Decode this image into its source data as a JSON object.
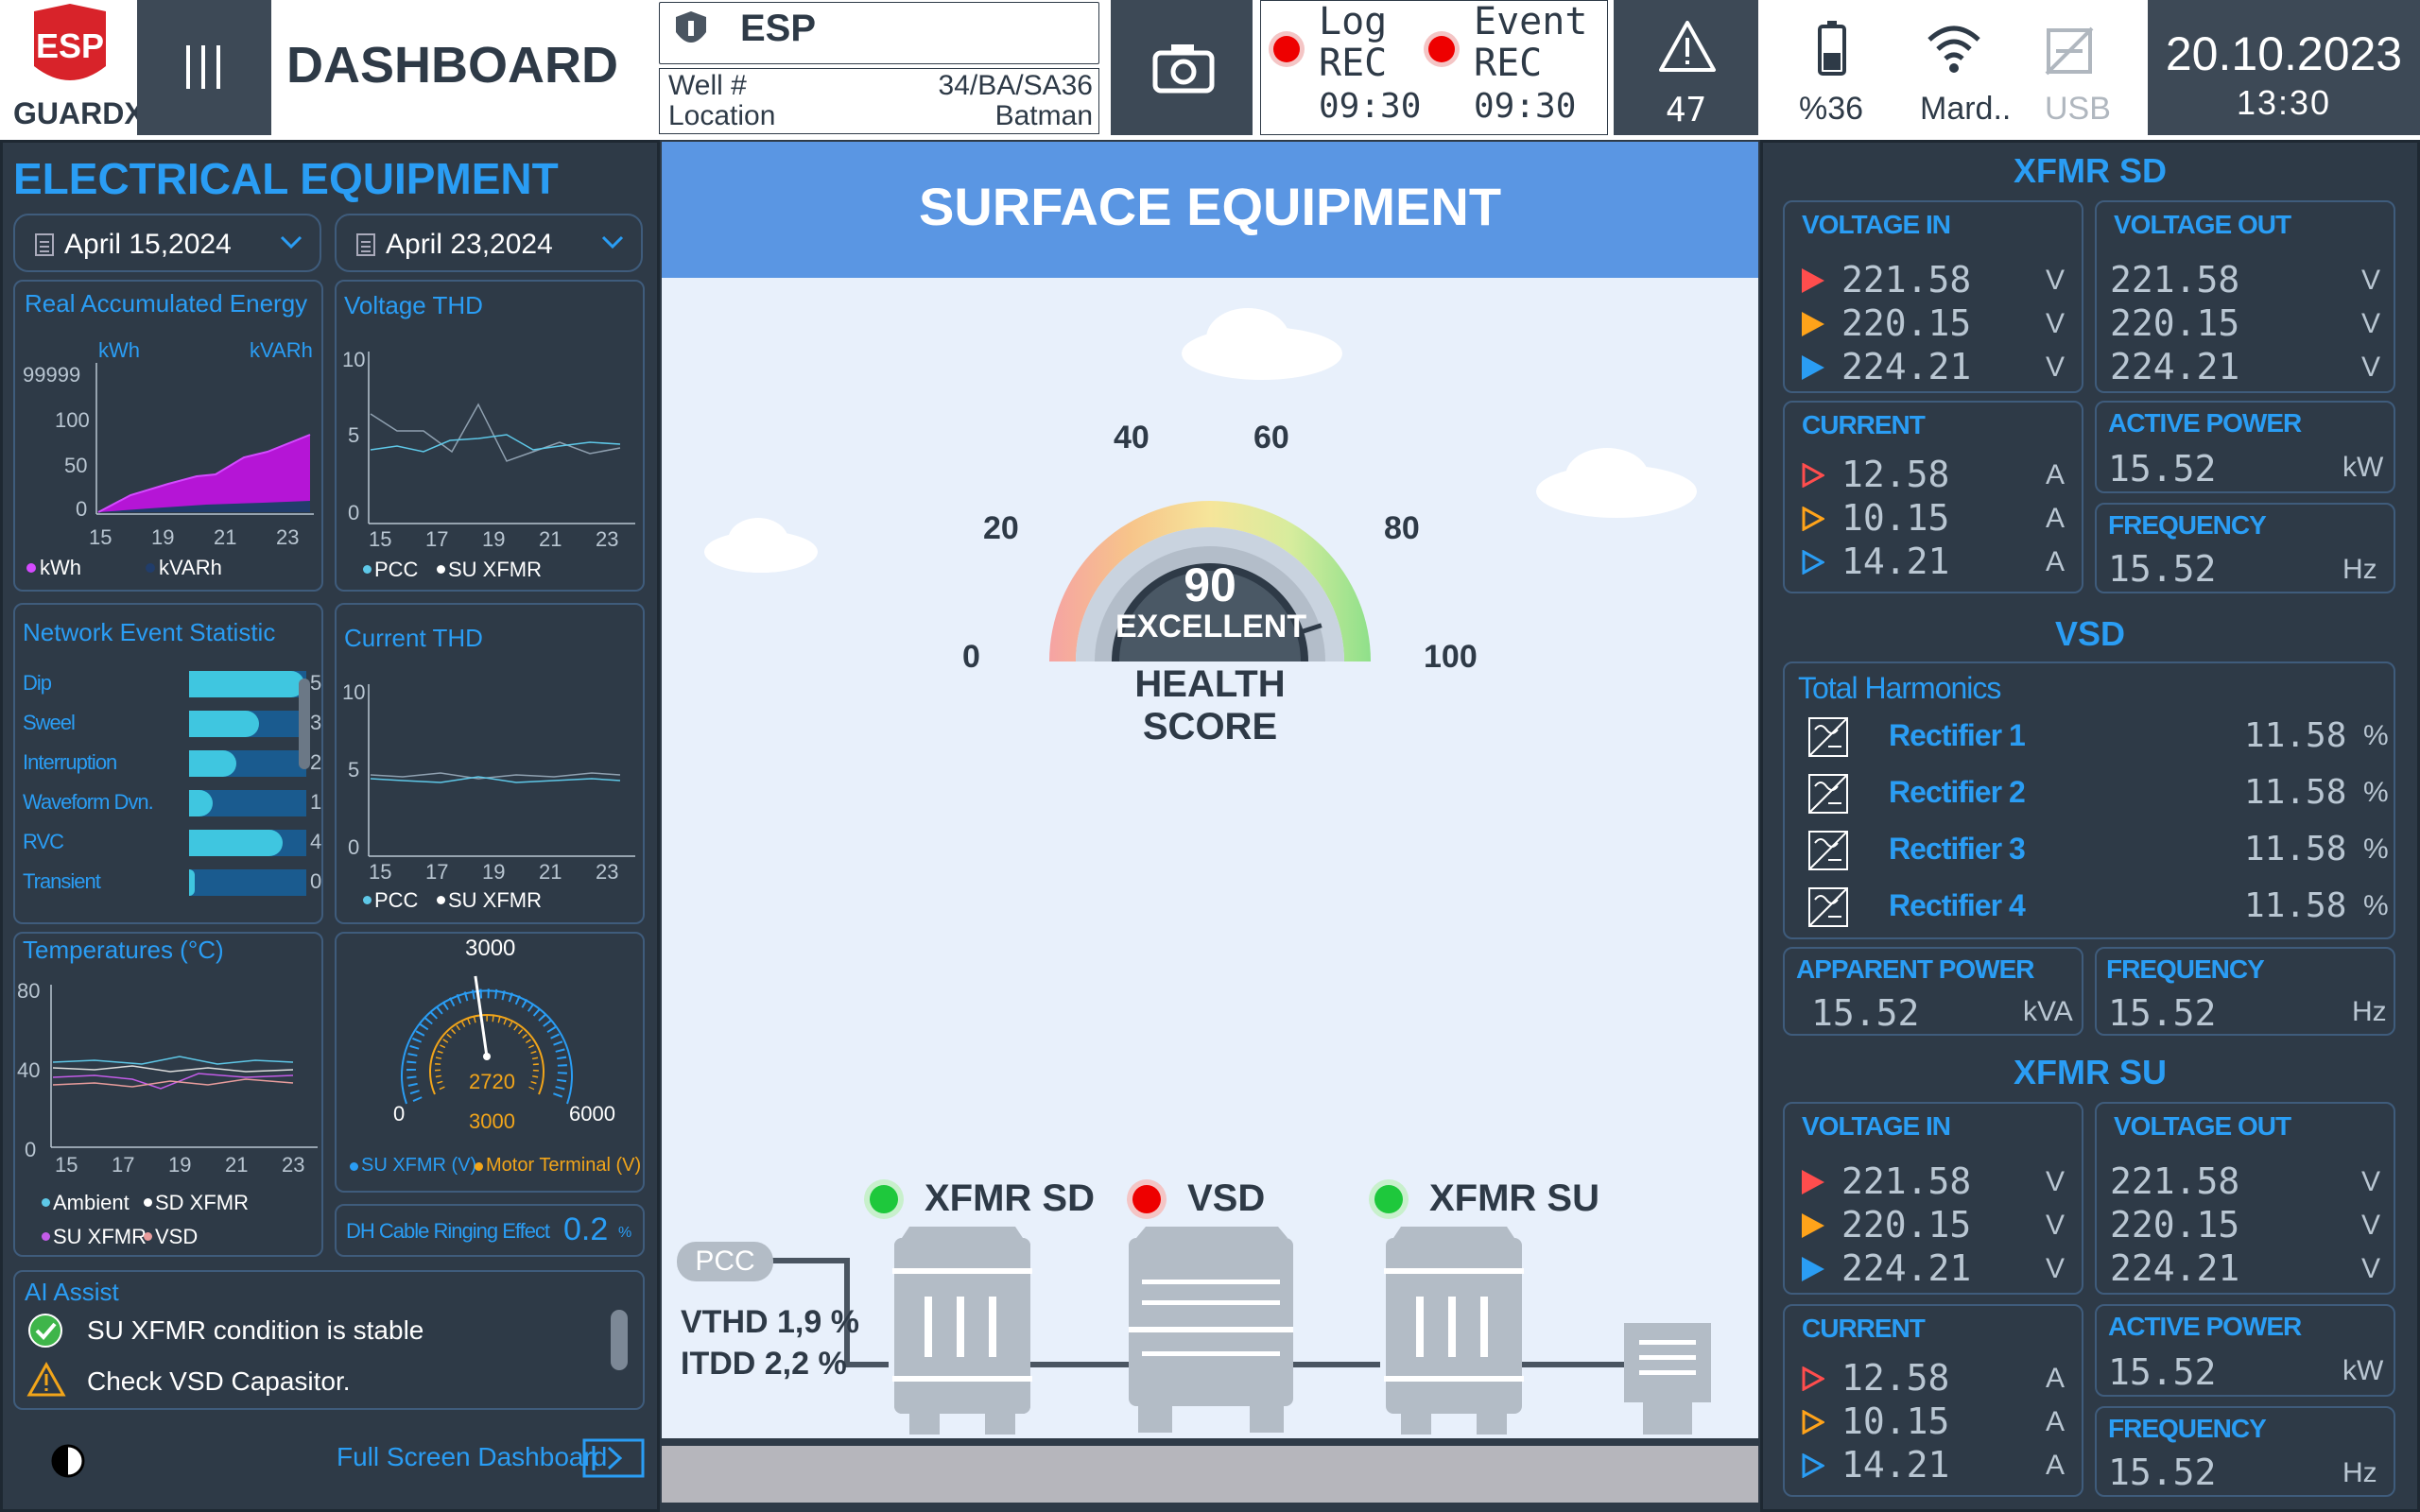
{
  "header": {
    "logo_top": "ESP",
    "logo_bottom": "GUARDX",
    "title": "DASHBOARD",
    "device": "ESP",
    "well_label": "Well #",
    "well_value": "34/BA/SA36",
    "location_label": "Location",
    "location_value": "Batman",
    "log_rec": {
      "line1": "Log",
      "line2": "REC",
      "time": "09:30"
    },
    "event_rec": {
      "line1": "Event",
      "line2": "REC",
      "time": "09:30"
    },
    "alerts": "47",
    "battery": "%36",
    "wifi": "Mard..",
    "usb": "USB",
    "date": "20.10.2023",
    "time": "13:30"
  },
  "left": {
    "title": "ELECTRICAL EQUIPMENT",
    "date_from": "April 15,2024",
    "date_to": "April 23,2024",
    "energy": {
      "title": "Real Accumulated Energy",
      "unit1": "kWh",
      "unit2": "kVARh",
      "yticks": [
        "99999",
        "100",
        "50",
        "0"
      ],
      "xticks": [
        "15",
        "19",
        "21",
        "23"
      ],
      "legend": [
        "kWh",
        "kVARh"
      ]
    },
    "vthd": {
      "title": "Voltage THD",
      "yticks": [
        "10",
        "5",
        "0"
      ],
      "xticks": [
        "15",
        "17",
        "19",
        "21",
        "23"
      ],
      "legend": [
        "PCC",
        "SU XFMR"
      ]
    },
    "network": {
      "title": "Network Event Statistic",
      "rows": [
        {
          "label": "Dip",
          "value": "5",
          "fill": 0.98
        },
        {
          "label": "Sweel",
          "value": "3",
          "fill": 0.6
        },
        {
          "label": "Interruption",
          "value": "2",
          "fill": 0.4
        },
        {
          "label": "Waveform Dvn.",
          "value": "1",
          "fill": 0.2
        },
        {
          "label": "RVC",
          "value": "4",
          "fill": 0.8
        },
        {
          "label": "Transient",
          "value": "0",
          "fill": 0.05
        }
      ]
    },
    "cthd": {
      "title": "Current THD",
      "yticks": [
        "10",
        "5",
        "0"
      ],
      "xticks": [
        "15",
        "17",
        "19",
        "21",
        "23"
      ],
      "legend": [
        "PCC",
        "SU XFMR"
      ]
    },
    "temps": {
      "title": "Temperatures (°C)",
      "yticks": [
        "80",
        "40",
        "0"
      ],
      "xticks": [
        "15",
        "17",
        "19",
        "21",
        "23"
      ],
      "legend": [
        "Ambient",
        "SD XFMR",
        "SU XFMR",
        "VSD"
      ]
    },
    "gauge": {
      "max_top": "3000",
      "min": "0",
      "max": "6000",
      "value": "2720",
      "ref": "3000",
      "legend": [
        "SU XFMR (V)",
        "Motor Terminal (V)"
      ],
      "needle_fraction": 0.47
    },
    "ringing": {
      "label": "DH Cable Ringing Effect",
      "value": "0.2",
      "unit": "%"
    },
    "ai": {
      "title": "AI Assist",
      "items": [
        "SU XFMR condition is stable",
        "Check VSD Capasitor."
      ]
    },
    "fullscreen": "Full Screen Dashboard"
  },
  "center": {
    "title": "SURFACE EQUIPMENT",
    "health": {
      "score": "90",
      "status": "EXCELLENT",
      "label": "HEALTH SCORE",
      "score_fraction": 0.9,
      "ticks": [
        "0",
        "20",
        "40",
        "60",
        "80",
        "100"
      ]
    },
    "pcc": "PCC",
    "vthd": "VTHD 1,9 %",
    "itdd": "ITDD 2,2 %",
    "equipment": [
      {
        "name": "XFMR SD",
        "status": "green"
      },
      {
        "name": "VSD",
        "status": "red"
      },
      {
        "name": "XFMR SU",
        "status": "green"
      }
    ]
  },
  "right": {
    "xfmr_sd": {
      "title": "XFMR SD",
      "vin_label": "VOLTAGE IN",
      "vout_label": "VOLTAGE OUT",
      "vin": [
        "221.58",
        "220.15",
        "224.21"
      ],
      "vout": [
        "221.58",
        "220.15",
        "224.21"
      ],
      "v_unit": "V",
      "current_label": "CURRENT",
      "current": [
        "12.58",
        "10.15",
        "14.21"
      ],
      "a_unit": "A",
      "ap_label": "ACTIVE POWER",
      "ap": "15.52",
      "ap_unit": "kW",
      "freq_label": "FREQUENCY",
      "freq": "15.52",
      "freq_unit": "Hz"
    },
    "vsd": {
      "title": "VSD",
      "harm_title": "Total Harmonics",
      "rectifiers": [
        {
          "name": "Rectifier 1",
          "value": "11.58",
          "unit": "%"
        },
        {
          "name": "Rectifier 2",
          "value": "11.58",
          "unit": "%"
        },
        {
          "name": "Rectifier 3",
          "value": "11.58",
          "unit": "%"
        },
        {
          "name": "Rectifier 4",
          "value": "11.58",
          "unit": "%"
        }
      ],
      "app_label": "APPARENT POWER",
      "app": "15.52",
      "app_unit": "kVA",
      "freq_label": "FREQUENCY",
      "freq": "15.52",
      "freq_unit": "Hz"
    },
    "xfmr_su": {
      "title": "XFMR SU",
      "vin_label": "VOLTAGE IN",
      "vout_label": "VOLTAGE OUT",
      "vin": [
        "221.58",
        "220.15",
        "224.21"
      ],
      "vout": [
        "221.58",
        "220.15",
        "224.21"
      ],
      "v_unit": "V",
      "current_label": "CURRENT",
      "current": [
        "12.58",
        "10.15",
        "14.21"
      ],
      "a_unit": "A",
      "ap_label": "ACTIVE POWER",
      "ap": "15.52",
      "ap_unit": "kW",
      "freq_label": "FREQUENCY",
      "freq": "15.52",
      "freq_unit": "Hz"
    }
  },
  "colors": {
    "accent": "#2a9df4",
    "panel": "#2e3a47",
    "header_blue": "#5a96e3",
    "phase1": "#ff4d4d",
    "phase2": "#ffa31a",
    "phase3": "#2a9df4"
  }
}
